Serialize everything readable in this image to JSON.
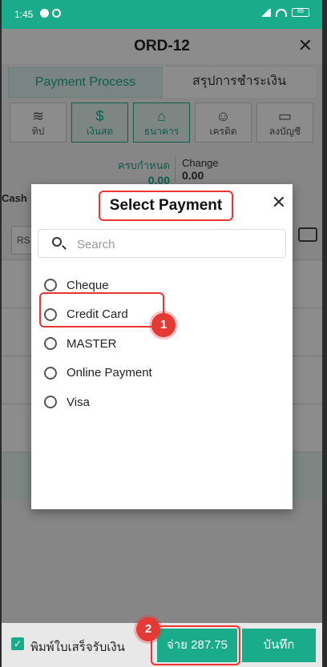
{
  "statusbar": {
    "time": "1:45",
    "battery": "89"
  },
  "header": {
    "title": "ORD-12"
  },
  "tabs": [
    {
      "label": "Payment Process"
    },
    {
      "label": "สรุปการชำระเงิน"
    }
  ],
  "payment_types": [
    {
      "label": "ทิป",
      "icon": "coins-icon"
    },
    {
      "label": "เงินสด",
      "icon": "dollar-icon"
    },
    {
      "label": "ธนาคาร",
      "icon": "bank-icon"
    },
    {
      "label": "เครดิต",
      "icon": "person-icon"
    },
    {
      "label": "ลงบัญชี",
      "icon": "bed-icon"
    }
  ],
  "summary": {
    "due_label": "ครบกำหนด",
    "due_value": "0.00",
    "change_label": "Change",
    "change_value": "0.00"
  },
  "cash_label": "Cash",
  "rs_label": "RS",
  "dialog": {
    "title": "Select Payment",
    "search_placeholder": "Search",
    "options": [
      "Cheque",
      "Credit Card",
      "MASTER",
      "Online Payment",
      "Visa"
    ]
  },
  "badges": {
    "one": "1",
    "two": "2"
  },
  "bottom": {
    "print_label": "พิมพ์ใบเสร็จรับเงิน",
    "pay_label": "จ่าย 287.75",
    "save_label": "บันทึก"
  },
  "colors": {
    "accent": "#1aab8a",
    "highlight": "#e33333"
  }
}
